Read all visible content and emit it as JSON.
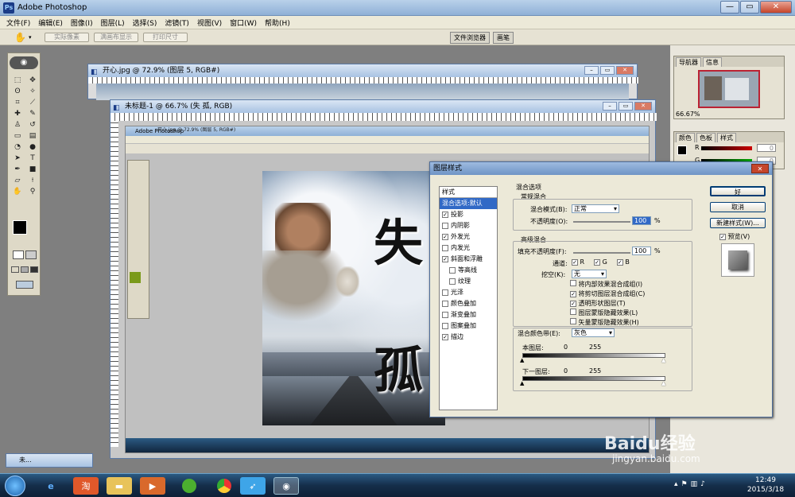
{
  "app": {
    "title": "Adobe Photoshop",
    "menus": [
      "文件(F)",
      "编辑(E)",
      "图像(I)",
      "图层(L)",
      "选择(S)",
      "滤镜(T)",
      "视图(V)",
      "窗口(W)",
      "帮助(H)"
    ]
  },
  "options_bar": {
    "buttons": [
      "实际像素",
      "满画布显示",
      "打印尺寸"
    ],
    "well_tabs": [
      "文件浏览器",
      "画笔"
    ]
  },
  "doc1": {
    "title": "开心.jpg @ 72.9% (图层 5, RGB#)"
  },
  "doc2": {
    "title": "未标题-1 @ 66.7% (失 孤, RGB)"
  },
  "nested": {
    "title": "Adobe Photoshop",
    "doc_title": "开心.jpg @ 72.9% (图层 5, RGB#)"
  },
  "artwork": {
    "char1": "失",
    "char2": "孤"
  },
  "right_panels": {
    "nav_tabs": [
      "导航器",
      "信息"
    ],
    "zoom": "66.67%",
    "color_tabs": [
      "颜色",
      "色板",
      "样式"
    ],
    "r_label": "R",
    "g_label": "G",
    "r_value": "0",
    "g_value": "0"
  },
  "dialog": {
    "title": "图层样式",
    "styles_header": "样式",
    "styles": [
      {
        "label": "混合选项:默认",
        "checked": null,
        "selected": true
      },
      {
        "label": "投影",
        "checked": true
      },
      {
        "label": "内阴影",
        "checked": false
      },
      {
        "label": "外发光",
        "checked": true
      },
      {
        "label": "内发光",
        "checked": false
      },
      {
        "label": "斜面和浮雕",
        "checked": true
      },
      {
        "label": "等高线",
        "checked": false,
        "indent": true
      },
      {
        "label": "纹理",
        "checked": false,
        "indent": true
      },
      {
        "label": "光泽",
        "checked": false
      },
      {
        "label": "颜色叠加",
        "checked": false
      },
      {
        "label": "渐变叠加",
        "checked": false
      },
      {
        "label": "图案叠加",
        "checked": false
      },
      {
        "label": "描边",
        "checked": true
      }
    ],
    "blend_options_title": "混合选项",
    "general_title": "常规混合",
    "blend_mode_label": "混合模式(B):",
    "blend_mode_value": "正常",
    "opacity_label": "不透明度(O):",
    "opacity_value": "100",
    "percent": "%",
    "advanced_title": "高级混合",
    "fill_label": "填充不透明度(F):",
    "fill_value": "100",
    "channels_label": "通道:",
    "channel_r": "R",
    "channel_g": "G",
    "channel_b": "B",
    "knockout_label": "挖空(K):",
    "knockout_value": "无",
    "adv_options": [
      {
        "label": "将内部效果混合成组(I)",
        "checked": false
      },
      {
        "label": "将剪切图层混合成组(C)",
        "checked": true
      },
      {
        "label": "透明形状图层(T)",
        "checked": true
      },
      {
        "label": "图层蒙版隐藏效果(L)",
        "checked": false
      },
      {
        "label": "矢量蒙版隐藏效果(H)",
        "checked": false
      }
    ],
    "blend_if_label": "混合颜色带(E):",
    "blend_if_value": "灰色",
    "this_layer_label": "本图层:",
    "under_layer_label": "下一图层:",
    "range_low": "0",
    "range_high": "255",
    "ok": "好",
    "cancel": "取消",
    "new_style": "新建样式(W)...",
    "preview": "预览(V)"
  },
  "minimized": {
    "label": "未..."
  },
  "taskbar": {
    "time": "12:49",
    "date": "2015/3/18"
  },
  "watermark": {
    "brand": "Baidu经验",
    "url": "jingyan.baidu.com"
  }
}
